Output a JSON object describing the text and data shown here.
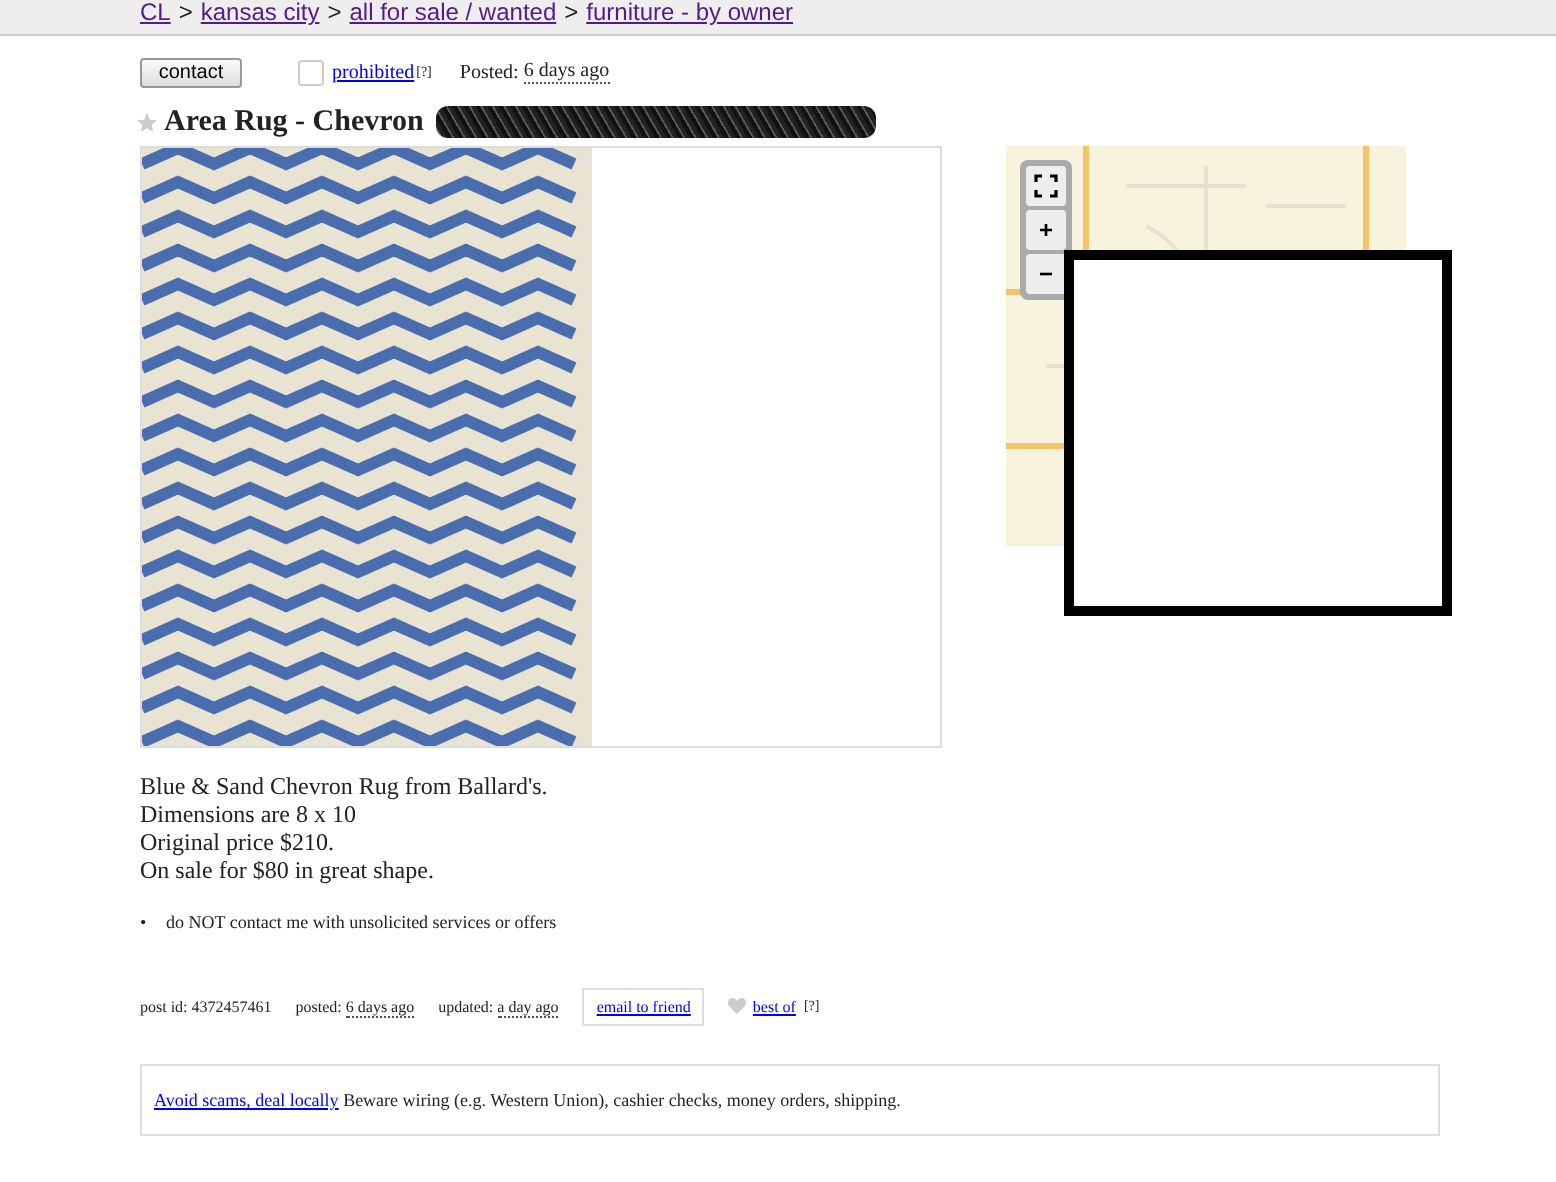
{
  "breadcrumbs": [
    {
      "label": "CL"
    },
    {
      "label": "kansas city"
    },
    {
      "label": "all for sale / wanted"
    },
    {
      "label": "furniture - by owner"
    }
  ],
  "separators": [
    ">",
    ">",
    ">"
  ],
  "actions": {
    "contact_button": "contact",
    "prohibited_checked": false,
    "prohibited_link": "prohibited",
    "help_mark": "[?]",
    "posted_label": "Posted:",
    "posted_value": "6 days ago"
  },
  "title": {
    "favorited": false,
    "text": "Area Rug - Chevron"
  },
  "map": {
    "zoom_in": "+",
    "zoom_out": "−"
  },
  "body": [
    "Blue & Sand Chevron Rug from Ballard's.",
    "Dimensions are 8 x 10",
    "Original price $210.",
    "On sale for $80 in great shape."
  ],
  "notices": [
    {
      "bullet": "•",
      "text": "do NOT contact me with unsolicited services or offers"
    }
  ],
  "footer": {
    "post_id": "post id: 4372457461",
    "posted_label": "posted:",
    "posted_value": "6 days ago",
    "updated_label": "updated:",
    "updated_value": "a day ago",
    "email_button": "email to friend",
    "best_of_favorited": false,
    "best_of_link": "best of",
    "help_mark": "[?]"
  },
  "scam_notice": {
    "link": "Avoid scams, deal locally",
    "text": "Beware wiring (e.g. Western Union), cashier checks, money orders, shipping."
  }
}
